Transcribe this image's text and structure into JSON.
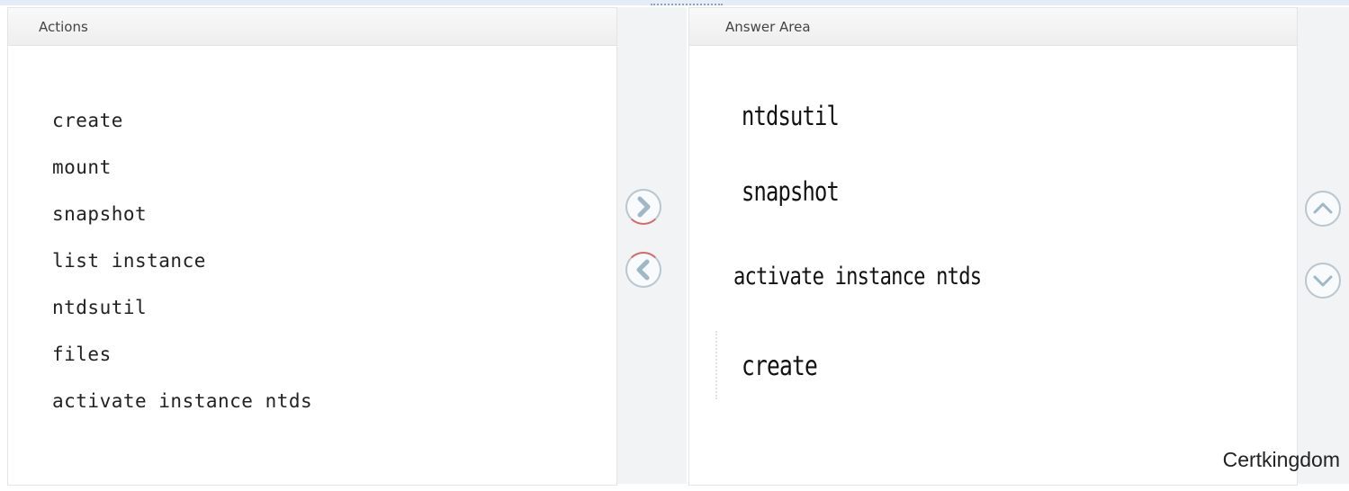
{
  "actions": {
    "header": "Actions",
    "items": [
      "create",
      "mount",
      "snapshot",
      "list instance",
      "ntdsutil",
      "files",
      "activate instance ntds"
    ]
  },
  "answer_area": {
    "header": "Answer Area",
    "items": [
      "ntdsutil",
      "snapshot",
      "activate instance ntds",
      "create"
    ]
  },
  "controls": {
    "move_right_icon": "chevron-right-icon",
    "move_left_icon": "chevron-left-icon",
    "move_up_icon": "chevron-up-icon",
    "move_down_icon": "chevron-down-icon",
    "icon_color": "#9fb8c6"
  },
  "watermark": "Certkingdom"
}
